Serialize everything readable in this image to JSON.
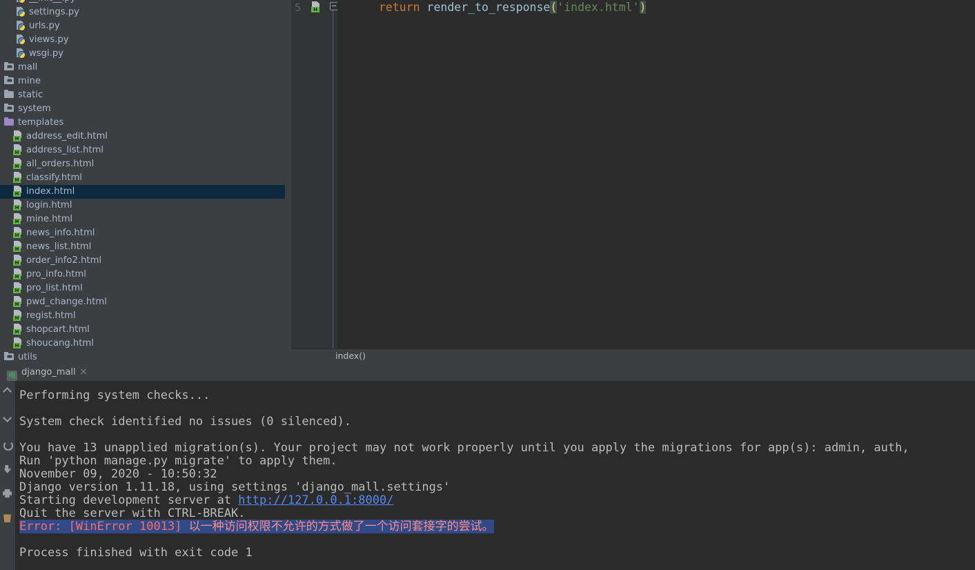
{
  "tree": {
    "rows": [
      {
        "label": "__init__.py",
        "icon": "python-file-icon",
        "indent": 22,
        "type": "py",
        "partial": true
      },
      {
        "label": "settings.py",
        "icon": "python-file-icon",
        "indent": 22,
        "type": "py"
      },
      {
        "label": "urls.py",
        "icon": "python-file-icon",
        "indent": 22,
        "type": "py"
      },
      {
        "label": "views.py",
        "icon": "python-file-icon",
        "indent": 22,
        "type": "py"
      },
      {
        "label": "wsgi.py",
        "icon": "python-file-icon",
        "indent": 22,
        "type": "py"
      },
      {
        "label": "mall",
        "icon": "module-folder-icon",
        "indent": 6,
        "type": "folder-mod"
      },
      {
        "label": "mine",
        "icon": "module-folder-icon",
        "indent": 6,
        "type": "folder-mod"
      },
      {
        "label": "static",
        "icon": "folder-icon",
        "indent": 6,
        "type": "folder"
      },
      {
        "label": "system",
        "icon": "module-folder-icon",
        "indent": 6,
        "type": "folder-mod"
      },
      {
        "label": "templates",
        "icon": "templates-folder-icon",
        "indent": 6,
        "type": "folder-tpl"
      },
      {
        "label": "address_edit.html",
        "icon": "html-file-icon",
        "indent": 18,
        "type": "html"
      },
      {
        "label": "address_list.html",
        "icon": "html-file-icon",
        "indent": 18,
        "type": "html"
      },
      {
        "label": "all_orders.html",
        "icon": "html-file-icon",
        "indent": 18,
        "type": "html"
      },
      {
        "label": "classify.html",
        "icon": "html-file-icon",
        "indent": 18,
        "type": "html"
      },
      {
        "label": "index.html",
        "icon": "html-file-icon",
        "indent": 18,
        "type": "html",
        "selected": true
      },
      {
        "label": "login.html",
        "icon": "html-file-icon",
        "indent": 18,
        "type": "html"
      },
      {
        "label": "mine.html",
        "icon": "html-file-icon",
        "indent": 18,
        "type": "html"
      },
      {
        "label": "news_info.html",
        "icon": "html-file-icon",
        "indent": 18,
        "type": "html"
      },
      {
        "label": "news_list.html",
        "icon": "html-file-icon",
        "indent": 18,
        "type": "html"
      },
      {
        "label": "order_info2.html",
        "icon": "html-file-icon",
        "indent": 18,
        "type": "html"
      },
      {
        "label": "pro_info.html",
        "icon": "html-file-icon",
        "indent": 18,
        "type": "html"
      },
      {
        "label": "pro_list.html",
        "icon": "html-file-icon",
        "indent": 18,
        "type": "html"
      },
      {
        "label": "pwd_change.html",
        "icon": "html-file-icon",
        "indent": 18,
        "type": "html"
      },
      {
        "label": "regist.html",
        "icon": "html-file-icon",
        "indent": 18,
        "type": "html"
      },
      {
        "label": "shopcart.html",
        "icon": "html-file-icon",
        "indent": 18,
        "type": "html"
      },
      {
        "label": "shoucang.html",
        "icon": "html-file-icon",
        "indent": 18,
        "type": "html"
      },
      {
        "label": "utils",
        "icon": "module-folder-icon",
        "indent": 6,
        "type": "folder-mod"
      }
    ]
  },
  "editor": {
    "line_number": "5",
    "file_type_icon": "html-file-icon",
    "fold_icon": "fold-collapse-icon",
    "intention_icon": "lightbulb-icon",
    "code": {
      "keyword": "return",
      "function": " render_to_response",
      "open_paren": "(",
      "string": "'index.html'",
      "close_paren": ")"
    },
    "breadcrumb": "index()"
  },
  "run": {
    "tab_label": "django_mall",
    "tab_icon": "django-icon",
    "tab_close_icon": "close-icon",
    "toolbar_icons": [
      "scroll-up-icon",
      "scroll-down-icon",
      "rerun-icon",
      "soft-wrap-icon",
      "print-icon",
      "clear-all-icon"
    ],
    "console_lines": [
      {
        "text": "",
        "partial": true
      },
      {
        "text": "Performing system checks..."
      },
      {
        "text": ""
      },
      {
        "text": "System check identified no issues (0 silenced)."
      },
      {
        "text": ""
      },
      {
        "text": "You have 13 unapplied migration(s). Your project may not work properly until you apply the migrations for app(s): admin, auth,"
      },
      {
        "text": "Run 'python manage.py migrate' to apply them."
      },
      {
        "text": "November 09, 2020 - 10:50:32"
      },
      {
        "text": "Django version 1.11.18, using settings 'django_mall.settings'"
      },
      {
        "text": "Starting development server at ",
        "link": "http://127.0.0.1:8000/"
      },
      {
        "text": "Quit the server with CTRL-BREAK."
      },
      {
        "error_prefix": "Error: [WinError 10013]",
        "error_message": " 以一种访问权限不允许的方式做了一个访问套接字的尝试。",
        "selected": true
      },
      {
        "text": ""
      },
      {
        "text": "Process finished with exit code 1"
      }
    ]
  },
  "colors": {
    "ide_bg": "#3c3f41",
    "editor_bg": "#2b2b2b",
    "gutter_bg": "#313335",
    "text": "#a9b7c6",
    "selection_tree": "#0d293e",
    "selection_console": "#2f4a87",
    "error_red": "#ff6b68",
    "link_blue": "#548af7",
    "keyword_orange": "#cc7832",
    "string_green": "#6a8759",
    "html_badge_green": "#62b543",
    "templates_purple": "#9e86c8"
  }
}
